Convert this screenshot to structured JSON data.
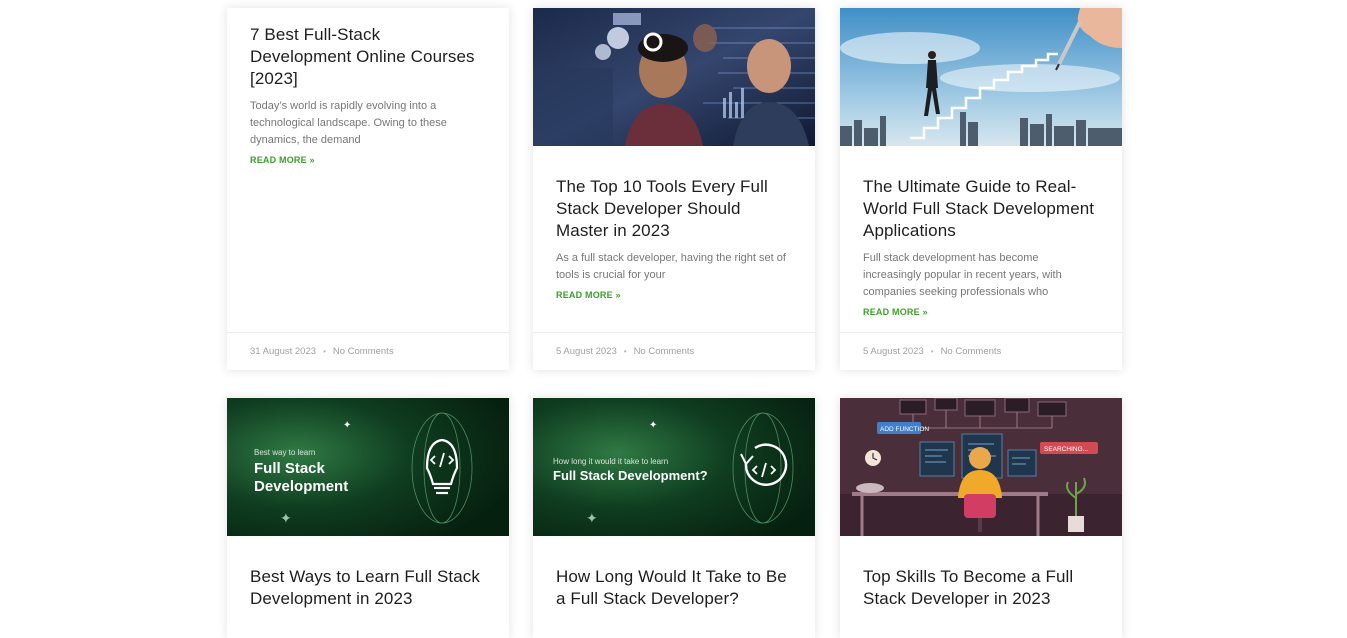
{
  "posts": [
    {
      "title": "7 Best Full-Stack Development Online Courses [2023]",
      "excerpt": "Today’s world is rapidly evolving into a technological landscape. Owing to these dynamics, the demand",
      "read_more": "READ MORE »",
      "date": "31 August 2023",
      "separator": "•",
      "comments": "No Comments"
    },
    {
      "title": "The Top 10 Tools Every Full Stack Developer Should Master in 2023",
      "excerpt": "As a full stack developer, having the right set of tools is crucial for your",
      "read_more": "READ MORE »",
      "date": "5 August 2023",
      "separator": "•",
      "comments": "No Comments"
    },
    {
      "title": "The Ultimate Guide to Real-World Full Stack Development Applications",
      "excerpt": "Full stack development has become increasingly popular in recent years, with companies seeking professionals who",
      "read_more": "READ MORE »",
      "date": "5 August 2023",
      "separator": "•",
      "comments": "No Comments"
    },
    {
      "title": "Best Ways to Learn Full Stack Development in 2023",
      "image_text": {
        "small": "Best way to learn",
        "big_line1": "Full Stack",
        "big_line2": "Development"
      }
    },
    {
      "title": "How Long Would It Take to Be a Full Stack Developer?",
      "image_text": {
        "small": "How long it would it take to learn",
        "big": "Full Stack Development?"
      }
    },
    {
      "title": "Top Skills To Become a Full Stack Developer in 2023",
      "image_text": {
        "tag1": "ADD FUNCTION",
        "tag2": "SEARCHING..."
      }
    }
  ],
  "colors": {
    "accent": "#3c9f2a",
    "meta_text": "#a0a0a0",
    "excerpt_text": "#777777",
    "title_text": "#1e1e1e",
    "dark_green": "#0d3a1c"
  }
}
